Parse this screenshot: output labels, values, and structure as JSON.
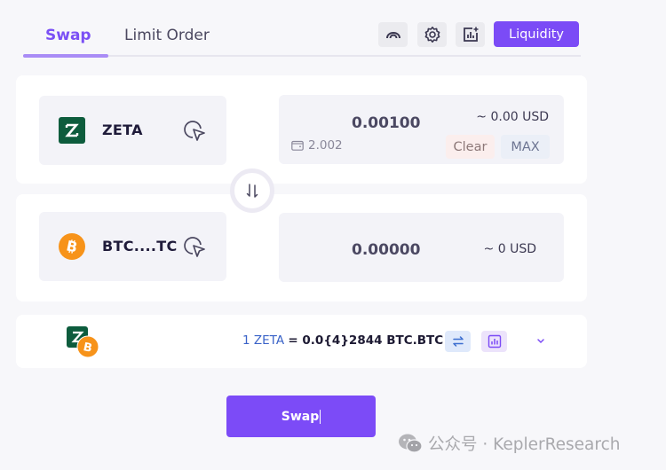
{
  "tabs": [
    {
      "label": "Swap",
      "active": true
    },
    {
      "label": "Limit Order",
      "active": false
    }
  ],
  "toolbar": {
    "icons": [
      "rainbow-arc-icon",
      "gear-icon",
      "chart-add-icon"
    ],
    "liquidity_label": "Liquidity",
    "accent": "#7b4bf6"
  },
  "from": {
    "token": "ZETA",
    "token_icon": "zeta-logo-icon",
    "amount": "0.00100",
    "usd": "~ 0.00 USD",
    "balance": "2.002",
    "clear_label": "Clear",
    "max_label": "MAX"
  },
  "to": {
    "token": "BTC....TC",
    "token_icon": "btc-logo-icon",
    "amount": "0.00000",
    "usd": "~ 0 USD"
  },
  "rate": {
    "lhs": "1 ZETA",
    "rhs": "= 0.0{4}2844 BTC.BTC"
  },
  "swap_button": {
    "label": "Swap"
  },
  "watermark": {
    "text": "公众号 · KeplerResearch"
  },
  "colors": {
    "zeta_green": "#0d5c3d",
    "btc_orange": "#f7931a",
    "clear_bg": "#fbeeed",
    "max_bg": "#ebeff7"
  }
}
